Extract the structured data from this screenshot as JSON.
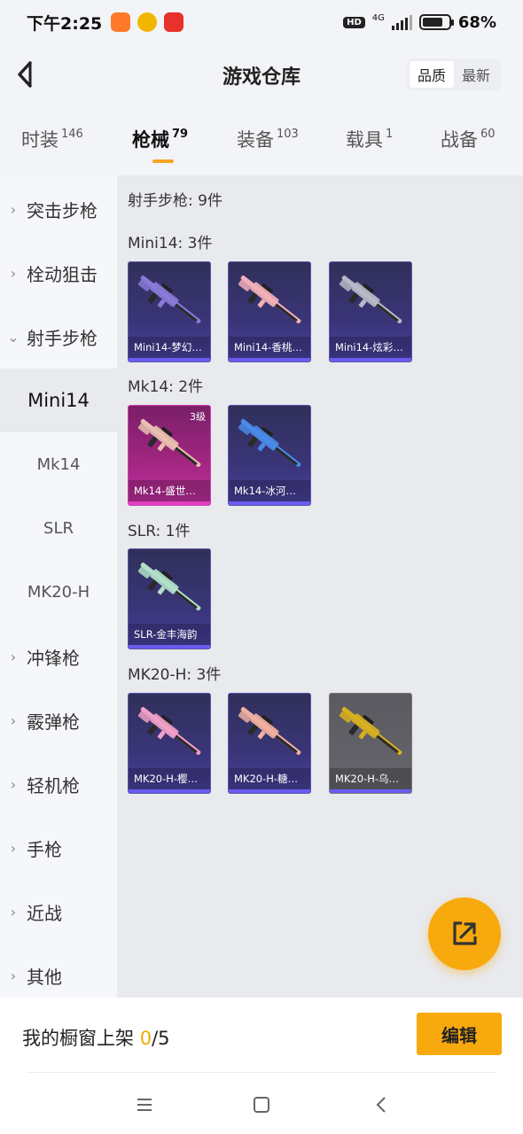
{
  "status": {
    "time": "下午2:25",
    "network": "4G",
    "hd": "HD",
    "battery_text": "68%",
    "battery_level": 0.68
  },
  "header": {
    "title": "游戏仓库",
    "sort_options": [
      "品质",
      "最新"
    ],
    "sort_selected": "品质"
  },
  "tabs": [
    {
      "label": "时装",
      "count": "146"
    },
    {
      "label": "枪械",
      "count": "79"
    },
    {
      "label": "装备",
      "count": "103"
    },
    {
      "label": "载具",
      "count": "1"
    },
    {
      "label": "战备",
      "count": "60"
    }
  ],
  "active_tab": "枪械",
  "sidebar": {
    "categories": [
      {
        "label": "突击步枪",
        "expanded": false
      },
      {
        "label": "栓动狙击",
        "expanded": false
      },
      {
        "label": "射手步枪",
        "expanded": true
      },
      {
        "label": "冲锋枪",
        "expanded": false
      },
      {
        "label": "霰弹枪",
        "expanded": false
      },
      {
        "label": "轻机枪",
        "expanded": false
      },
      {
        "label": "手枪",
        "expanded": false
      },
      {
        "label": "近战",
        "expanded": false
      },
      {
        "label": "其他",
        "expanded": false
      }
    ],
    "subitems": [
      "Mini14",
      "Mk14",
      "SLR",
      "MK20-H"
    ],
    "active_subitem": "Mini14"
  },
  "main": {
    "category_header": "射手步枪: 9件",
    "groups": [
      {
        "title": "Mini14: 3件",
        "items": [
          {
            "name": "Mini14-梦幻…",
            "color": "#8a7ad8"
          },
          {
            "name": "Mini14-香桃…",
            "color": "#f2b0b8"
          },
          {
            "name": "Mini14-炫彩…",
            "color": "#b8b8c8"
          }
        ]
      },
      {
        "title": "Mk14: 2件",
        "items": [
          {
            "name": "Mk14-盛世…",
            "level": "3级",
            "color": "#e8c0b0"
          },
          {
            "name": "Mk14-冰河…",
            "color": "#4a8ae8"
          }
        ]
      },
      {
        "title": "SLR: 1件",
        "items": [
          {
            "name": "SLR-金丰海韵",
            "color": "#b0e0c8"
          }
        ]
      },
      {
        "title": "MK20-H: 3件",
        "items": [
          {
            "name": "MK20-H-樱…",
            "color": "#f0a0c8"
          },
          {
            "name": "MK20-H-糖…",
            "color": "#f0b0a0"
          },
          {
            "name": "MK20-H-乌…",
            "color": "#d8b020"
          }
        ]
      }
    ]
  },
  "footer": {
    "showcase_label": "我的橱窗上架 ",
    "showcase_current": "0",
    "showcase_total": "/5",
    "edit_label": "编辑"
  },
  "colors": {
    "accent": "#f8a90e"
  }
}
